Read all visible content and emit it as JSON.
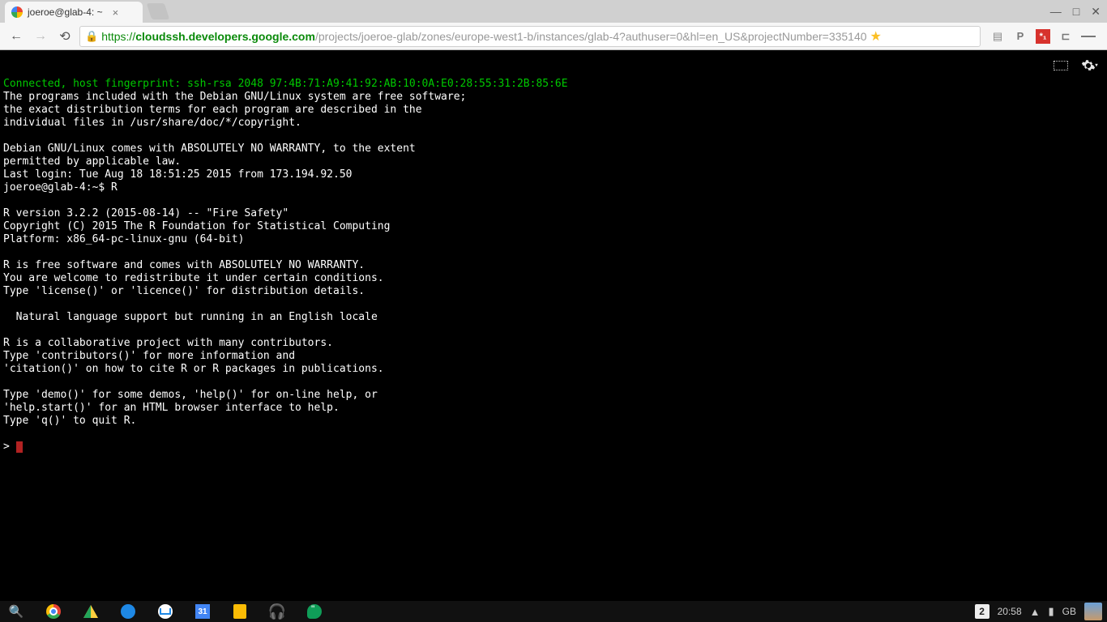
{
  "tab": {
    "title": "joeroe@glab-4: ~"
  },
  "window_controls": {
    "min": "—",
    "max": "□",
    "close": "✕"
  },
  "url": {
    "proto": "https://",
    "host": "cloudssh.developers.google.com",
    "path": "/projects/joeroe-glab/zones/europe-west1-b/instances/glab-4?authuser=0&hl=en_US&projectNumber=335140"
  },
  "terminal": {
    "fingerprint_line": "Connected, host fingerprint: ssh-rsa 2048 97:4B:71:A9:41:92:AB:10:0A:E0:28:55:31:2B:85:6E",
    "body": "\nThe programs included with the Debian GNU/Linux system are free software;\nthe exact distribution terms for each program are described in the\nindividual files in /usr/share/doc/*/copyright.\n\nDebian GNU/Linux comes with ABSOLUTELY NO WARRANTY, to the extent\npermitted by applicable law.\nLast login: Tue Aug 18 18:51:25 2015 from 173.194.92.50\njoeroe@glab-4:~$ R\n\nR version 3.2.2 (2015-08-14) -- \"Fire Safety\"\nCopyright (C) 2015 The R Foundation for Statistical Computing\nPlatform: x86_64-pc-linux-gnu (64-bit)\n\nR is free software and comes with ABSOLUTELY NO WARRANTY.\nYou are welcome to redistribute it under certain conditions.\nType 'license()' or 'licence()' for distribution details.\n\n  Natural language support but running in an English locale\n\nR is a collaborative project with many contributors.\nType 'contributors()' for more information and\n'citation()' on how to cite R or R packages in publications.\n\nType 'demo()' for some demos, 'help()' for on-line help, or\n'help.start()' for an HTML browser interface to help.\nType 'q()' to quit R.\n\n",
    "prompt": "> "
  },
  "taskbar": {
    "calendar_day": "31",
    "notifications": "2",
    "clock": "20:58",
    "keyboard_layout": "GB"
  }
}
